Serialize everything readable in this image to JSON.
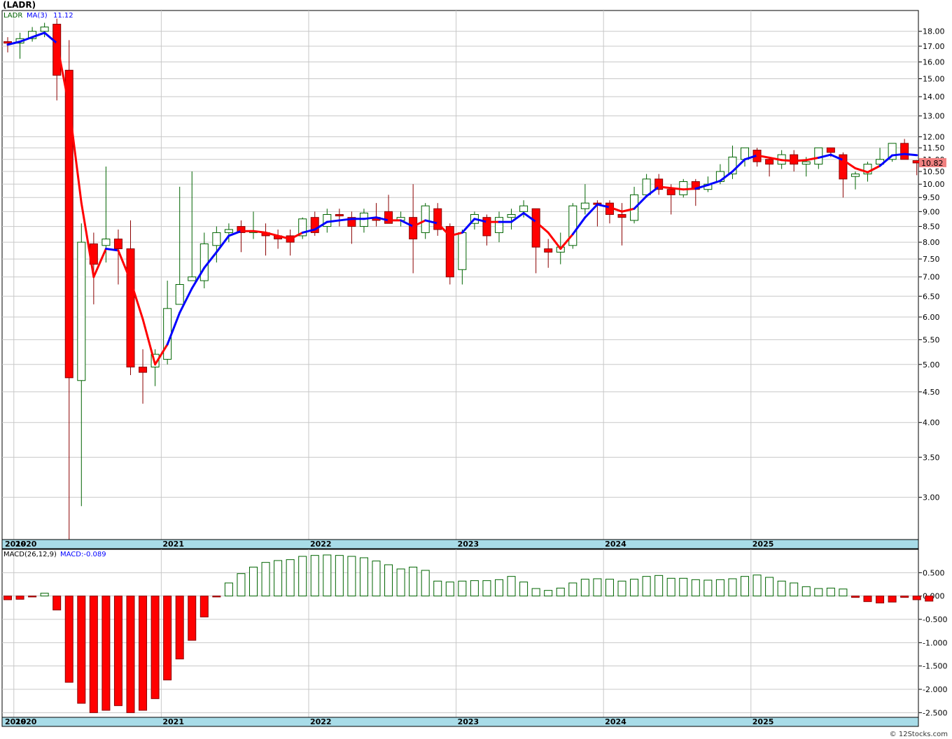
{
  "window": {
    "title": "(LADR)",
    "credit": "© 12Stocks.com"
  },
  "price_panel": {
    "legend_symbol": "LADR",
    "legend_ma_label": "MA(3)",
    "legend_ma_value": "11.12",
    "last_price_label": "10.82",
    "y_ticks": [
      "18.00",
      "17.00",
      "16.00",
      "15.00",
      "14.00",
      "13.00",
      "12.00",
      "11.50",
      "11.00",
      "10.50",
      "10.00",
      "9.50",
      "9.00",
      "8.50",
      "8.00",
      "7.50",
      "7.00",
      "6.50",
      "6.00",
      "5.50",
      "5.00",
      "4.50",
      "4.00",
      "3.50",
      "3.00"
    ]
  },
  "macd_panel": {
    "legend_params": "MACD(26,12,9)",
    "legend_value": "MACD:-0.089",
    "y_ticks": [
      "0.500",
      "0.000",
      "-0.500",
      "-1.000",
      "-1.500",
      "-2.000",
      "-2.500"
    ]
  },
  "x_axis": {
    "years": [
      "2019",
      "2020",
      "2021",
      "2022",
      "2023",
      "2024",
      "2025"
    ]
  },
  "colors": {
    "up_candle": "#006400",
    "down_candle": "#ff0000",
    "ma_up": "#0000ff",
    "ma_down": "#ff0000",
    "axis_band": "#a8dce8",
    "price_label_bg": "#f08080"
  },
  "chart_data": [
    {
      "type": "candlestick",
      "title": "(LADR)",
      "scale": "log",
      "ylim": [
        2.55,
        19.5
      ],
      "x_start": "2019-12",
      "ma_period": 3,
      "candles": [
        {
          "o": 17.3,
          "h": 17.6,
          "l": 16.6,
          "c": 17.2
        },
        {
          "o": 17.2,
          "h": 17.9,
          "l": 16.2,
          "c": 17.5
        },
        {
          "o": 17.5,
          "h": 18.3,
          "l": 17.3,
          "c": 18.0
        },
        {
          "o": 18.0,
          "h": 18.6,
          "l": 17.6,
          "c": 18.3
        },
        {
          "o": 18.5,
          "h": 18.9,
          "l": 13.8,
          "c": 15.2
        },
        {
          "o": 15.5,
          "h": 17.4,
          "l": 2.55,
          "c": 4.75
        },
        {
          "o": 4.7,
          "h": 8.6,
          "l": 2.9,
          "c": 8.0
        },
        {
          "o": 7.95,
          "h": 8.3,
          "l": 6.3,
          "c": 7.35
        },
        {
          "o": 7.9,
          "h": 10.7,
          "l": 7.4,
          "c": 8.1
        },
        {
          "o": 8.1,
          "h": 8.4,
          "l": 6.8,
          "c": 7.8
        },
        {
          "o": 7.8,
          "h": 8.7,
          "l": 4.8,
          "c": 4.95
        },
        {
          "o": 4.95,
          "h": 5.3,
          "l": 4.3,
          "c": 4.85
        },
        {
          "o": 4.95,
          "h": 5.3,
          "l": 4.6,
          "c": 5.2
        },
        {
          "o": 5.1,
          "h": 6.9,
          "l": 5.0,
          "c": 6.2
        },
        {
          "o": 6.3,
          "h": 9.9,
          "l": 6.3,
          "c": 6.8
        },
        {
          "o": 6.9,
          "h": 10.5,
          "l": 6.9,
          "c": 7.0
        },
        {
          "o": 6.9,
          "h": 8.3,
          "l": 6.7,
          "c": 7.95
        },
        {
          "o": 7.9,
          "h": 8.5,
          "l": 7.4,
          "c": 8.3
        },
        {
          "o": 8.3,
          "h": 8.6,
          "l": 8.0,
          "c": 8.4
        },
        {
          "o": 8.5,
          "h": 8.7,
          "l": 7.7,
          "c": 8.3
        },
        {
          "o": 8.3,
          "h": 9.0,
          "l": 8.1,
          "c": 8.35
        },
        {
          "o": 8.3,
          "h": 8.6,
          "l": 7.6,
          "c": 8.2
        },
        {
          "o": 8.2,
          "h": 8.4,
          "l": 7.8,
          "c": 8.1
        },
        {
          "o": 8.2,
          "h": 8.4,
          "l": 7.6,
          "c": 8.0
        },
        {
          "o": 8.2,
          "h": 8.8,
          "l": 8.1,
          "c": 8.75
        },
        {
          "o": 8.8,
          "h": 9.0,
          "l": 8.2,
          "c": 8.3
        },
        {
          "o": 8.5,
          "h": 9.1,
          "l": 8.3,
          "c": 8.9
        },
        {
          "o": 8.9,
          "h": 9.1,
          "l": 8.5,
          "c": 8.85
        },
        {
          "o": 8.8,
          "h": 9.0,
          "l": 7.95,
          "c": 8.5
        },
        {
          "o": 8.5,
          "h": 9.1,
          "l": 8.3,
          "c": 8.95
        },
        {
          "o": 8.8,
          "h": 9.3,
          "l": 8.5,
          "c": 8.7
        },
        {
          "o": 9.0,
          "h": 9.6,
          "l": 8.6,
          "c": 8.6
        },
        {
          "o": 8.7,
          "h": 9.0,
          "l": 8.5,
          "c": 8.8
        },
        {
          "o": 8.8,
          "h": 10.0,
          "l": 7.1,
          "c": 8.1
        },
        {
          "o": 8.3,
          "h": 9.3,
          "l": 8.1,
          "c": 9.2
        },
        {
          "o": 9.1,
          "h": 9.3,
          "l": 8.2,
          "c": 8.4
        },
        {
          "o": 8.5,
          "h": 8.6,
          "l": 6.8,
          "c": 7.0
        },
        {
          "o": 7.2,
          "h": 8.4,
          "l": 6.8,
          "c": 8.3
        },
        {
          "o": 8.6,
          "h": 9.0,
          "l": 8.4,
          "c": 8.9
        },
        {
          "o": 8.8,
          "h": 8.9,
          "l": 7.9,
          "c": 8.2
        },
        {
          "o": 8.3,
          "h": 9.0,
          "l": 8.0,
          "c": 8.8
        },
        {
          "o": 8.8,
          "h": 9.1,
          "l": 8.4,
          "c": 8.9
        },
        {
          "o": 9.0,
          "h": 9.4,
          "l": 8.8,
          "c": 9.2
        },
        {
          "o": 9.1,
          "h": 9.1,
          "l": 7.1,
          "c": 7.85
        },
        {
          "o": 7.8,
          "h": 8.1,
          "l": 7.25,
          "c": 7.7
        },
        {
          "o": 7.7,
          "h": 8.3,
          "l": 7.35,
          "c": 7.85
        },
        {
          "o": 7.9,
          "h": 9.3,
          "l": 7.8,
          "c": 9.2
        },
        {
          "o": 9.1,
          "h": 10.0,
          "l": 8.9,
          "c": 9.3
        },
        {
          "o": 9.3,
          "h": 9.4,
          "l": 8.5,
          "c": 9.25
        },
        {
          "o": 9.3,
          "h": 9.4,
          "l": 8.6,
          "c": 8.9
        },
        {
          "o": 8.9,
          "h": 9.3,
          "l": 7.9,
          "c": 8.8
        },
        {
          "o": 8.7,
          "h": 9.9,
          "l": 8.6,
          "c": 9.6
        },
        {
          "o": 9.6,
          "h": 10.4,
          "l": 9.5,
          "c": 10.2
        },
        {
          "o": 10.2,
          "h": 10.4,
          "l": 9.6,
          "c": 9.8
        },
        {
          "o": 9.8,
          "h": 10.0,
          "l": 8.9,
          "c": 9.6
        },
        {
          "o": 9.6,
          "h": 10.2,
          "l": 9.5,
          "c": 10.1
        },
        {
          "o": 10.1,
          "h": 10.2,
          "l": 9.2,
          "c": 9.8
        },
        {
          "o": 9.8,
          "h": 10.3,
          "l": 9.7,
          "c": 10.0
        },
        {
          "o": 10.1,
          "h": 10.8,
          "l": 10.0,
          "c": 10.5
        },
        {
          "o": 10.4,
          "h": 11.6,
          "l": 10.2,
          "c": 11.1
        },
        {
          "o": 11.0,
          "h": 11.5,
          "l": 10.7,
          "c": 11.5
        },
        {
          "o": 11.4,
          "h": 11.5,
          "l": 10.7,
          "c": 10.9
        },
        {
          "o": 11.0,
          "h": 11.1,
          "l": 10.3,
          "c": 10.8
        },
        {
          "o": 10.8,
          "h": 11.4,
          "l": 10.6,
          "c": 11.2
        },
        {
          "o": 11.2,
          "h": 11.4,
          "l": 10.5,
          "c": 10.8
        },
        {
          "o": 10.8,
          "h": 11.1,
          "l": 10.3,
          "c": 10.9
        },
        {
          "o": 10.8,
          "h": 11.5,
          "l": 10.6,
          "c": 11.5
        },
        {
          "o": 11.5,
          "h": 11.5,
          "l": 11.1,
          "c": 11.3
        },
        {
          "o": 11.2,
          "h": 11.3,
          "l": 9.5,
          "c": 10.2
        },
        {
          "o": 10.3,
          "h": 10.5,
          "l": 9.8,
          "c": 10.4
        },
        {
          "o": 10.4,
          "h": 10.9,
          "l": 10.1,
          "c": 10.8
        },
        {
          "o": 10.8,
          "h": 11.5,
          "l": 10.7,
          "c": 11.0
        },
        {
          "o": 11.0,
          "h": 11.7,
          "l": 10.9,
          "c": 11.7
        },
        {
          "o": 11.7,
          "h": 11.9,
          "l": 11.0,
          "c": 11.0
        },
        {
          "o": 10.95,
          "h": 10.97,
          "l": 10.35,
          "c": 10.85
        }
      ],
      "ma": [
        17.1,
        17.3,
        17.6,
        17.9,
        17.2,
        13.5,
        9.3,
        7.0,
        7.8,
        7.75,
        6.9,
        5.95,
        5.0,
        5.4,
        6.1,
        6.7,
        7.25,
        7.7,
        8.2,
        8.35,
        8.35,
        8.3,
        8.2,
        8.1,
        8.3,
        8.4,
        8.65,
        8.7,
        8.75,
        8.75,
        8.8,
        8.7,
        8.7,
        8.5,
        8.7,
        8.6,
        8.2,
        8.3,
        8.75,
        8.65,
        8.65,
        8.65,
        8.95,
        8.65,
        8.3,
        7.8,
        8.25,
        8.8,
        9.25,
        9.15,
        9.0,
        9.1,
        9.55,
        9.9,
        9.85,
        9.8,
        9.83,
        9.97,
        10.13,
        10.5,
        11.0,
        11.17,
        11.07,
        10.97,
        10.93,
        10.97,
        11.07,
        11.2,
        10.97,
        10.63,
        10.47,
        10.73,
        11.17,
        11.23,
        11.18
      ],
      "ma_color": [
        "up",
        "up",
        "up",
        "up",
        "down",
        "down",
        "down",
        "down",
        "up",
        "down",
        "down",
        "down",
        "down",
        "up",
        "up",
        "up",
        "up",
        "up",
        "up",
        "down",
        "down",
        "down",
        "down",
        "down",
        "up",
        "up",
        "up",
        "up",
        "up",
        "up",
        "up",
        "down",
        "up",
        "down",
        "up",
        "down",
        "down",
        "up",
        "up",
        "down",
        "up",
        "up",
        "up",
        "down",
        "down",
        "down",
        "up",
        "up",
        "up",
        "down",
        "down",
        "up",
        "up",
        "down",
        "down",
        "down",
        "up",
        "up",
        "up",
        "up",
        "up",
        "down",
        "down",
        "down",
        "down",
        "down",
        "up",
        "up",
        "down",
        "down",
        "down",
        "up",
        "up",
        "up",
        "down"
      ]
    },
    {
      "type": "bar",
      "title": "MACD(26,12,9)",
      "ylim": [
        -2.6,
        1.0
      ],
      "values": [
        -0.08,
        -0.07,
        -0.02,
        0.06,
        -0.3,
        -1.85,
        -2.3,
        -2.5,
        -2.45,
        -2.35,
        -2.5,
        -2.45,
        -2.2,
        -1.8,
        -1.35,
        -0.95,
        -0.45,
        -0.02,
        0.28,
        0.48,
        0.62,
        0.72,
        0.76,
        0.78,
        0.85,
        0.87,
        0.88,
        0.87,
        0.85,
        0.82,
        0.75,
        0.67,
        0.58,
        0.62,
        0.55,
        0.32,
        0.3,
        0.32,
        0.33,
        0.33,
        0.35,
        0.42,
        0.3,
        0.16,
        0.12,
        0.17,
        0.28,
        0.36,
        0.37,
        0.36,
        0.32,
        0.36,
        0.42,
        0.44,
        0.38,
        0.38,
        0.35,
        0.34,
        0.35,
        0.37,
        0.42,
        0.45,
        0.4,
        0.32,
        0.28,
        0.2,
        0.16,
        0.17,
        0.15,
        -0.03,
        -0.12,
        -0.15,
        -0.13,
        -0.03,
        -0.08,
        -0.11
      ]
    }
  ]
}
